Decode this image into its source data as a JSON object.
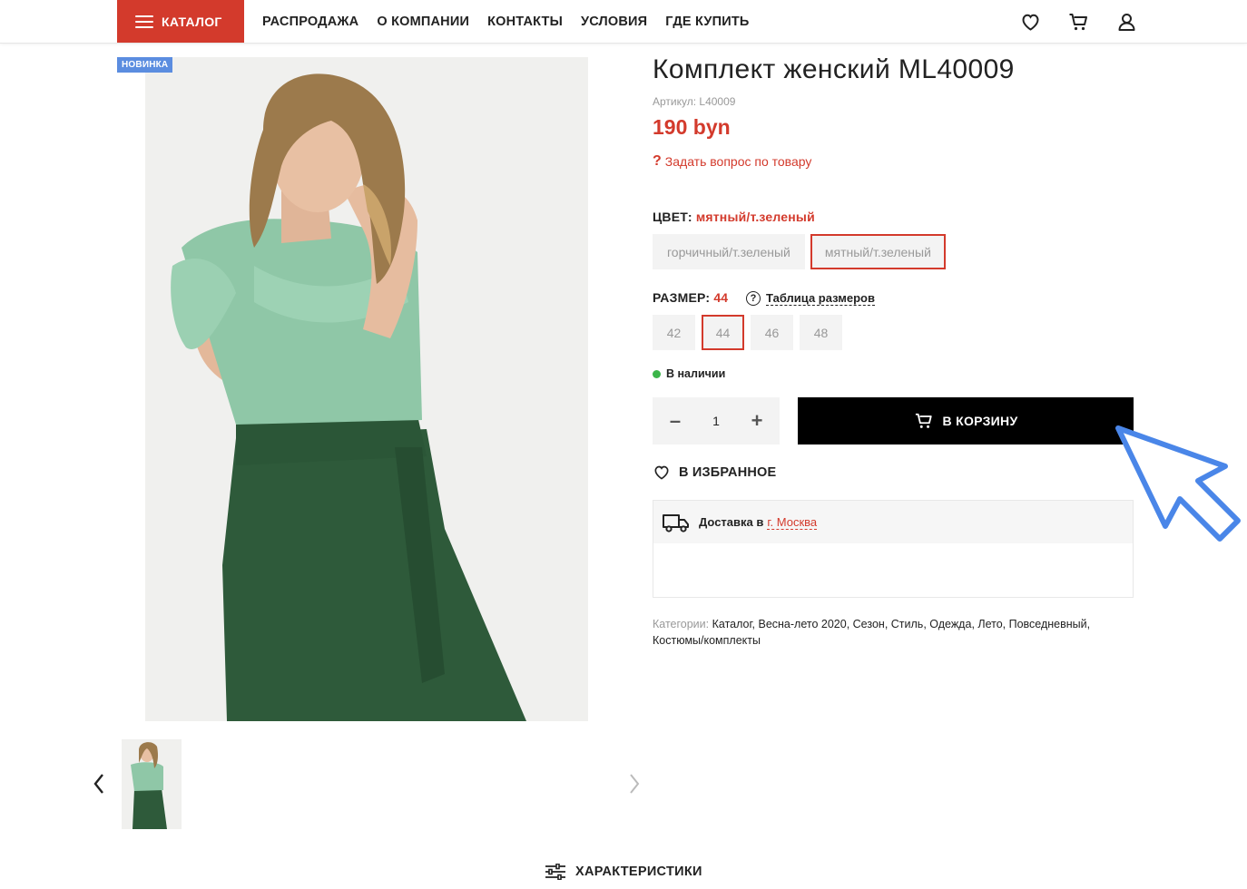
{
  "header": {
    "catalog_label": "КАТАЛОГ",
    "nav": [
      "РАСПРОДАЖА",
      "О КОМПАНИИ",
      "КОНТАКТЫ",
      "УСЛОВИЯ",
      "ГДЕ КУПИТЬ"
    ],
    "icons": [
      "heart-icon",
      "cart-icon",
      "user-icon"
    ]
  },
  "gallery": {
    "badge": "НОВИНКА"
  },
  "product": {
    "title": "Комплект женский ML40009",
    "sku": "Артикул: L40009",
    "price": "190 byn",
    "ask": "Задать вопрос по товару",
    "color_label": "ЦВЕТ:",
    "color_value": "мятный/т.зеленый",
    "colors": [
      "горчичный/т.зеленый",
      "мятный/т.зеленый"
    ],
    "selected_color_index": 1,
    "size_label": "РАЗМЕР:",
    "size_value": "44",
    "size_table": "Таблица размеров",
    "sizes": [
      "42",
      "44",
      "46",
      "48"
    ],
    "selected_size_index": 1,
    "stock": "В наличии",
    "quantity": "1",
    "cart_label": "В КОРЗИНУ",
    "favorite_label": "В ИЗБРАННОЕ",
    "delivery_label": "Доставка в",
    "delivery_city": "г. Москва",
    "categories_label": "Категории:",
    "categories": [
      "Каталог",
      "Весна-лето 2020",
      "Сезон",
      "Стиль",
      "Одежда",
      "Лето",
      "Повседневный",
      "Костюмы/комплекты"
    ]
  },
  "tabs": {
    "characteristics": "ХАРАКТЕРИСТИКИ"
  },
  "colors": {
    "accent": "#d33a2c",
    "badge": "#5b8de0",
    "in_stock": "#3cb54a",
    "cursor": "#4a86e8"
  }
}
